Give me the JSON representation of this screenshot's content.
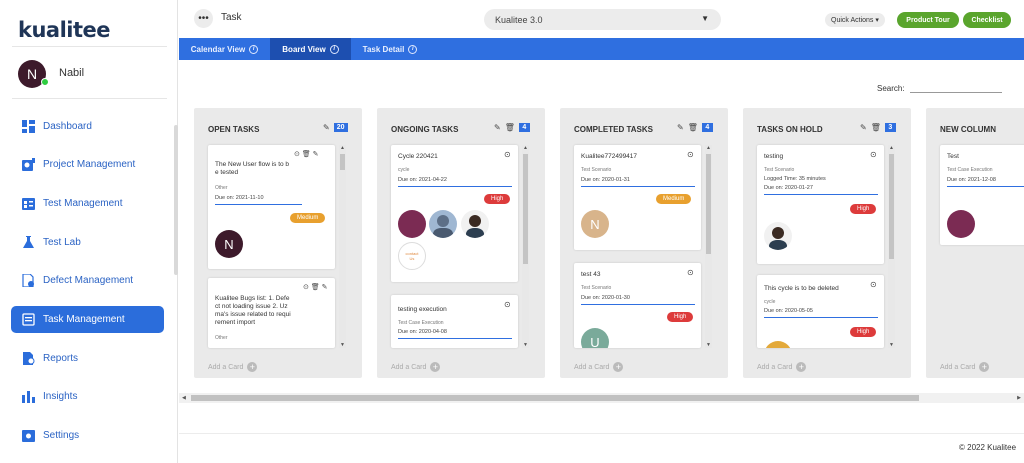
{
  "app": {
    "logo": "kualitee"
  },
  "user": {
    "initial": "N",
    "name": "Nabil"
  },
  "sidebar": {
    "items": [
      {
        "label": "Dashboard",
        "icon": "dashboard-icon"
      },
      {
        "label": "Project Management",
        "icon": "project-icon"
      },
      {
        "label": "Test Management",
        "icon": "test-management-icon"
      },
      {
        "label": "Test Lab",
        "icon": "flask-icon"
      },
      {
        "label": "Defect Management",
        "icon": "defect-icon"
      },
      {
        "label": "Task Management",
        "icon": "task-icon",
        "active": true
      },
      {
        "label": "Reports",
        "icon": "reports-icon"
      },
      {
        "label": "Insights",
        "icon": "insights-icon"
      },
      {
        "label": "Settings",
        "icon": "settings-icon"
      }
    ]
  },
  "header": {
    "dots": "•••",
    "title": "Task",
    "project": "Kualitee 3.0",
    "quick_actions": "Quick Actions ▾",
    "product_tour": "Product Tour",
    "checklist": "Checklist"
  },
  "tabs": [
    {
      "label": "Calendar View"
    },
    {
      "label": "Board View",
      "active": true
    },
    {
      "label": "Task Detail"
    }
  ],
  "search": {
    "label": "Search:"
  },
  "columns": [
    {
      "title": "OPEN TASKS",
      "count": "20",
      "add": "Add a Card"
    },
    {
      "title": "ONGOING TASKS",
      "count": "4",
      "add": "Add a Card"
    },
    {
      "title": "COMPLETED TASKS",
      "count": "4",
      "add": "Add a Card"
    },
    {
      "title": "TASKS ON HOLD",
      "count": "3",
      "add": "Add a Card"
    },
    {
      "title": "NEW COLUMN",
      "add": "Add a Card"
    }
  ],
  "cards": {
    "c0a": {
      "title1": "The New User flow is to b",
      "title2": "e tested",
      "sub": "Other",
      "due": "Due on: 2021-11-10",
      "priority": "Medium",
      "avatar": "N"
    },
    "c0b": {
      "l1": "Kualitee Bugs list: 1. Defe",
      "l2": "ct not loading issue 2. Uz",
      "l3": "ma's issue related to requi",
      "l4": "rement import",
      "sub": "Other"
    },
    "c1a": {
      "title": "Cycle 220421",
      "sub": "cycle",
      "due": "Due on: 2021-04-22",
      "priority": "High",
      "contact": "contact",
      "contact2": "Us"
    },
    "c1b": {
      "title": "testing execution",
      "sub": "Test Case Execution",
      "due": "Due on: 2020-04-08"
    },
    "c2a": {
      "title": "Kualitee772499417",
      "sub": "Test Scenario",
      "due": "Due on: 2020-01-31",
      "priority": "Medium",
      "avatar": "N"
    },
    "c2b": {
      "title": "test 43",
      "sub": "Test Scenario",
      "due": "Due on: 2020-01-30",
      "priority": "High",
      "avatar": "U"
    },
    "c3a": {
      "title": "testing",
      "sub": "Test Scenario",
      "logged": "Logged Time: 35 minutes",
      "due": "Due on: 2020-01-27",
      "priority": "High"
    },
    "c3b": {
      "title": "This cycle is to be deleted",
      "sub": "cycle",
      "due": "Due on: 2020-05-05",
      "priority": "High"
    },
    "c4a": {
      "title": "Test",
      "sub": "Test Case Execution",
      "due": "Due on: 2021-12-08"
    }
  },
  "footer": {
    "copyright": "© 2022 Kualitee"
  },
  "colors": {
    "accent": "#2f6fe0",
    "green": "#5aa52d",
    "medium": "#e8a02e",
    "high": "#dd3b3b"
  }
}
